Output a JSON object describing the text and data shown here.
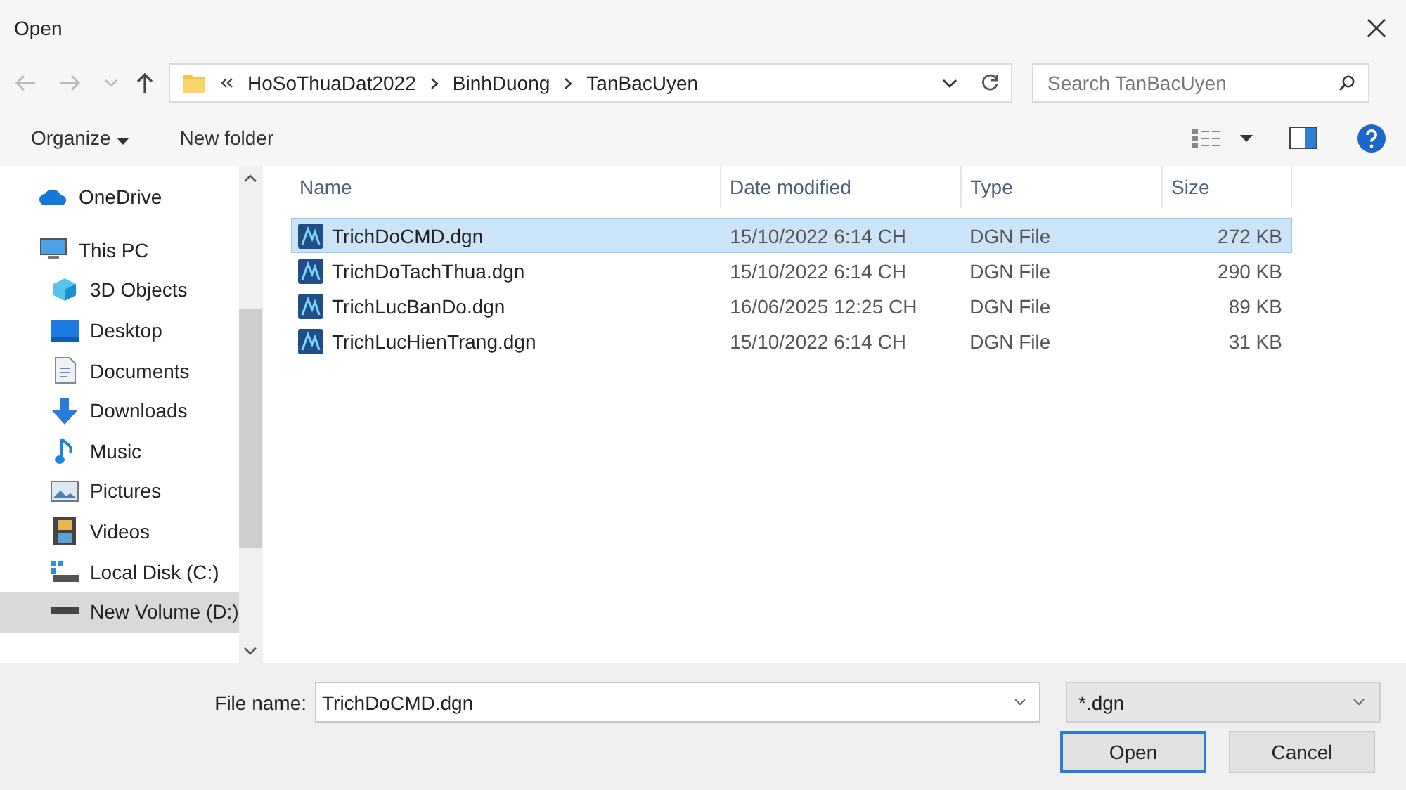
{
  "window": {
    "title": "Open"
  },
  "address": {
    "path": [
      "HoSoThuaDat2022",
      "BinhDuong",
      "TanBacUyen"
    ]
  },
  "search": {
    "placeholder": "Search TanBacUyen"
  },
  "toolbar": {
    "organize": "Organize",
    "new_folder": "New folder"
  },
  "sidebar": {
    "items": [
      {
        "label": "OneDrive",
        "kind": "cloud",
        "selected": false
      },
      {
        "label": "This PC",
        "kind": "pc",
        "selected": false,
        "children": [
          {
            "label": "3D Objects",
            "kind": "cube",
            "selected": false
          },
          {
            "label": "Desktop",
            "kind": "desktop",
            "selected": false
          },
          {
            "label": "Documents",
            "kind": "doc",
            "selected": false
          },
          {
            "label": "Downloads",
            "kind": "download",
            "selected": false
          },
          {
            "label": "Music",
            "kind": "music",
            "selected": false
          },
          {
            "label": "Pictures",
            "kind": "picture",
            "selected": false
          },
          {
            "label": "Videos",
            "kind": "video",
            "selected": false
          },
          {
            "label": "Local Disk (C:)",
            "kind": "disk",
            "selected": false
          },
          {
            "label": "New Volume (D:)",
            "kind": "drive",
            "selected": true
          }
        ]
      }
    ]
  },
  "table": {
    "columns": [
      "Name",
      "Date modified",
      "Type",
      "Size"
    ],
    "rows": [
      {
        "name": "TrichDoCMD.dgn",
        "date": "15/10/2022 6:14 CH",
        "type": "DGN File",
        "size": "272 KB",
        "selected": true
      },
      {
        "name": "TrichDoTachThua.dgn",
        "date": "15/10/2022 6:14 CH",
        "type": "DGN File",
        "size": "290 KB",
        "selected": false
      },
      {
        "name": "TrichLucBanDo.dgn",
        "date": "16/06/2025 12:25 CH",
        "type": "DGN File",
        "size": "89 KB",
        "selected": false
      },
      {
        "name": "TrichLucHienTrang.dgn",
        "date": "15/10/2022 6:14 CH",
        "type": "DGN File",
        "size": "31 KB",
        "selected": false
      }
    ]
  },
  "footer": {
    "file_name_label": "File name:",
    "file_name": "TrichDoCMD.dgn",
    "filter": "*.dgn",
    "buttons": [
      "Open",
      "Cancel"
    ]
  }
}
